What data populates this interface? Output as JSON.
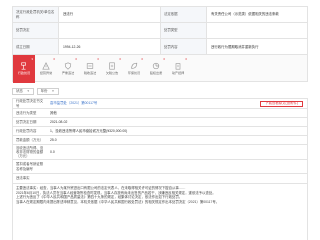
{
  "info": {
    "rows": [
      {
        "l1": "决定行政处罚机关/单位名称",
        "v1": "违法行",
        "l2": "法定依据",
        "v2": "有关责任公司（示范类）依据相关的违法条款"
      },
      {
        "l1": "处罚决定",
        "v1": "",
        "l2": "处罚类型",
        "v2": ""
      },
      {
        "l1": "成立日期",
        "v1": "1994-12-26",
        "l2": "处罚内容",
        "v2": "违行政行为限期取消并重新执行"
      }
    ]
  },
  "tabs": [
    {
      "count": "3",
      "label": "行政处罚",
      "icon": "gavel-icon",
      "active": true
    },
    {
      "count": "0",
      "label": "经营异常",
      "icon": "warning-icon"
    },
    {
      "count": "0",
      "label": "严重违法",
      "icon": "shield-icon"
    },
    {
      "count": "0",
      "label": "税收违法",
      "icon": "tax-icon"
    },
    {
      "count": "0",
      "label": "欠税公告",
      "icon": "document-icon"
    },
    {
      "count": "0",
      "label": "环保处罚",
      "icon": "leaf-icon"
    },
    {
      "count": "0",
      "label": "股权出质",
      "icon": "pie-icon"
    },
    {
      "count": "0",
      "label": "动产抵押",
      "icon": "building-icon"
    }
  ],
  "filters": [
    {
      "label": "状态"
    },
    {
      "label": "年份"
    }
  ],
  "detail": {
    "rows": [
      {
        "label": "行政处罚决定书文号",
        "value": "嘉市监罚处〔2021〕第00117号",
        "blue": true,
        "button": "下载查看原文(含附件)"
      },
      {
        "label": "违法行为类型",
        "value": "其他"
      },
      {
        "label": "处罚决定日期",
        "value": "2021-08-02"
      },
      {
        "label": "行政处罚内容",
        "value": "1、没收违法所得人民币叁拾贰万元整(¥320,000.00)"
      },
      {
        "label": "罚款金额（万元）",
        "value": "25.0"
      },
      {
        "label": "没收违法所得、没收非法财物的金额（万元）",
        "value": "0.0"
      },
      {
        "label": "暂扣或者吊销证照名称及编号",
        "value": ""
      },
      {
        "label": "违法事实",
        "value": ""
      }
    ],
    "fact_lines": [
      "主要违法事实：经查，当事人为某外贸进出口有限公司的法定代表人，在未取得相关许可证的情况下擅自从事……",
      "2021年6月10日，执法人员在当事人经营场所检查时发现，当事人存放有尚未出售的产品若干，涉嫌违反相关规定，遂依法予以查处。",
      "上述行为违反了《中华人民共和国产品质量法》第四十九条的规定，经集体讨论决定，依法作出如下行政处罚。",
      "当事人在规定期限内未提出陈述申辩意见，本机关依据《中华人民共和国行政处罚法》的相关规定作出本处罚决定（2021）第00117号。"
    ]
  }
}
